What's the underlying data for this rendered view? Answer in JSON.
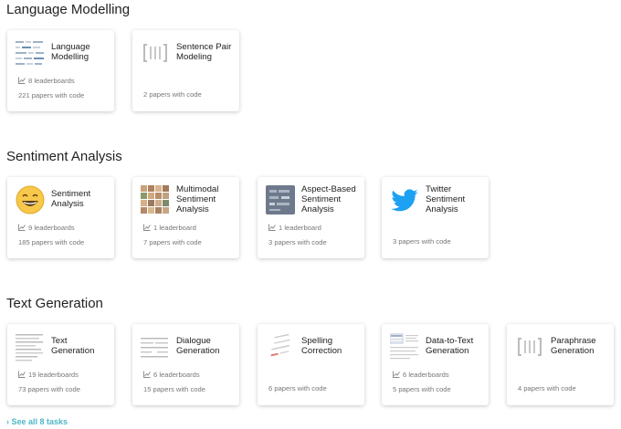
{
  "sections": [
    {
      "title": "Language Modelling",
      "cards": [
        {
          "title": "Language Modelling",
          "leaderboards": "8 leaderboards",
          "papers": "221 papers with code",
          "icon": "token-sequence-icon"
        },
        {
          "title": "Sentence Pair Modeling",
          "papers": "2 papers with code",
          "icon": "bracket-icon"
        }
      ]
    },
    {
      "title": "Sentiment Analysis",
      "cards": [
        {
          "title": "Sentiment Analysis",
          "leaderboards": "9 leaderboards",
          "papers": "185 papers with code",
          "icon": "smiley-icon"
        },
        {
          "title": "Multimodal Sentiment Analysis",
          "leaderboards": "1 leaderboard",
          "papers": "7 papers with code",
          "icon": "face-grid-icon"
        },
        {
          "title": "Aspect-Based Sentiment Analysis",
          "leaderboards": "1 leaderboard",
          "papers": "3 papers with code",
          "icon": "diagram-icon"
        },
        {
          "title": "Twitter Sentiment Analysis",
          "papers": "3 papers with code",
          "icon": "twitter-bird-icon"
        }
      ]
    },
    {
      "title": "Text Generation",
      "cards": [
        {
          "title": "Text Generation",
          "leaderboards": "19 leaderboards",
          "papers": "73 papers with code",
          "icon": "document-icon"
        },
        {
          "title": "Dialogue Generation",
          "leaderboards": "6 leaderboards",
          "papers": "15 papers with code",
          "icon": "dialogue-icon"
        },
        {
          "title": "Spelling Correction",
          "papers": "6 papers with code",
          "icon": "spelling-icon"
        },
        {
          "title": "Data-to-Text Generation",
          "leaderboards": "6 leaderboards",
          "papers": "5 papers with code",
          "icon": "table-icon"
        },
        {
          "title": "Paraphrase Generation",
          "papers": "4 papers with code",
          "icon": "bracket-icon"
        }
      ]
    }
  ],
  "see_all": "See all 8 tasks",
  "colors": {
    "link": "#4fb6c7",
    "muted": "#777777",
    "twitter": "#1da1f2",
    "smiley": "#f7c84a"
  }
}
